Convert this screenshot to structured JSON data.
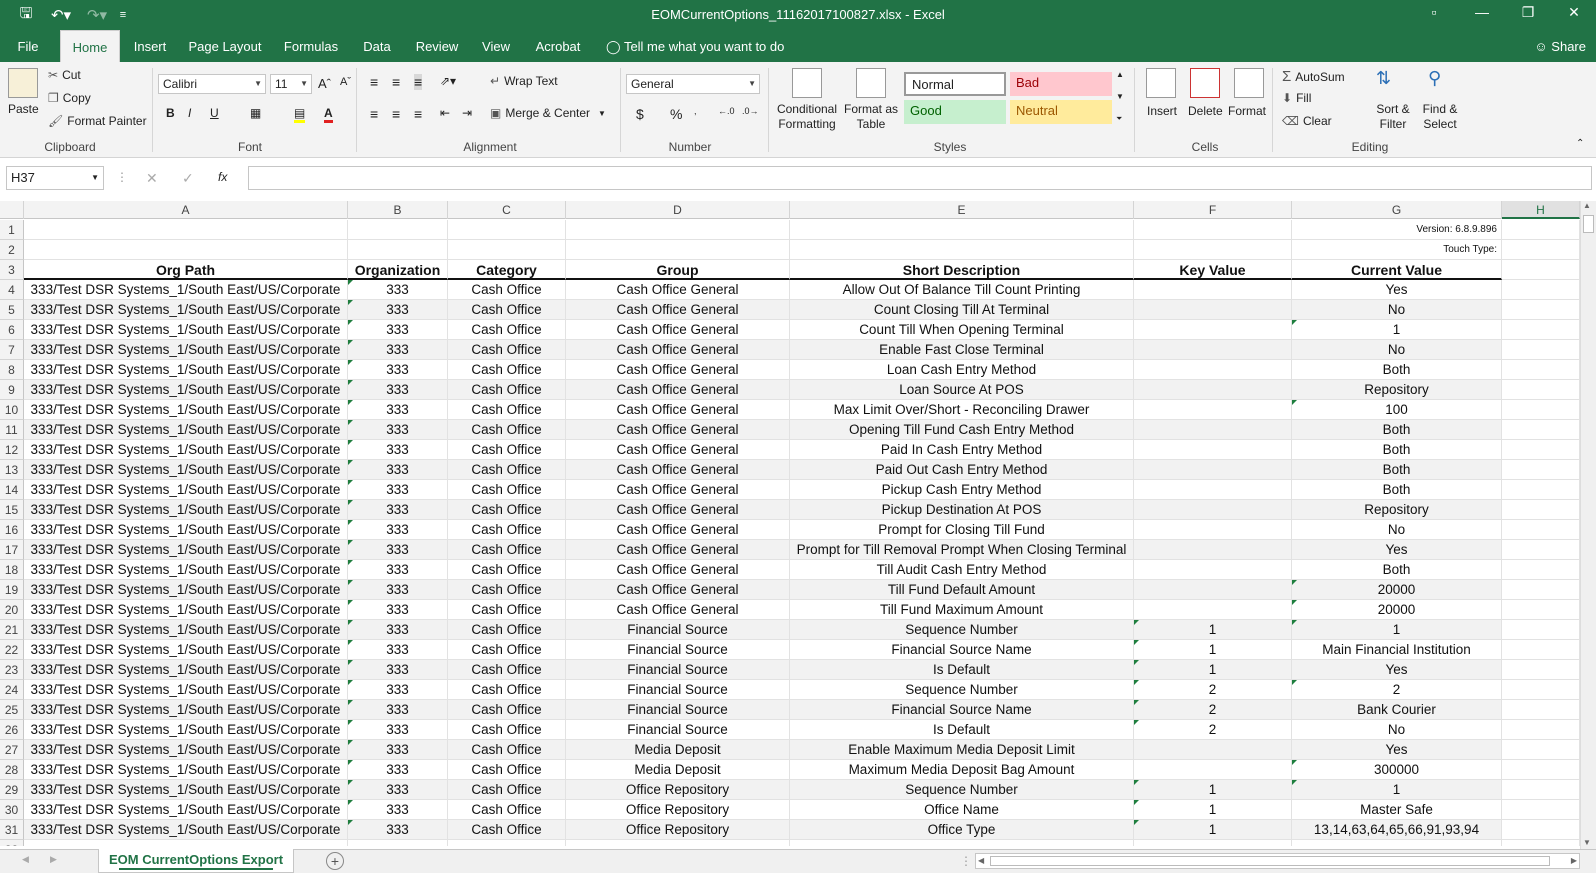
{
  "window": {
    "title": "EOMCurrentOptions_11162017100827.xlsx - Excel",
    "quick_access": [
      "save-icon",
      "undo-icon",
      "redo-icon",
      "customize-icon"
    ]
  },
  "tabs": [
    "File",
    "Home",
    "Insert",
    "Page Layout",
    "Formulas",
    "Data",
    "Review",
    "View",
    "Acrobat"
  ],
  "tell_me": "Tell me what you want to do",
  "share": "Share",
  "ribbon": {
    "clipboard": {
      "paste": "Paste",
      "cut": "Cut",
      "copy": "Copy",
      "format_painter": "Format Painter",
      "label": "Clipboard"
    },
    "font": {
      "name": "Calibri",
      "size": "11",
      "label": "Font",
      "bold": "B",
      "italic": "I",
      "underline": "U"
    },
    "alignment": {
      "wrap_text": "Wrap Text",
      "merge_center": "Merge & Center",
      "label": "Alignment"
    },
    "number": {
      "format": "General",
      "currency": "$",
      "percent": "%",
      "label": "Number"
    },
    "styles": {
      "conditional_formatting": "Conditional Formatting",
      "format_as_table": "Format as Table",
      "normal": "Normal",
      "bad": "Bad",
      "good": "Good",
      "neutral": "Neutral",
      "label": "Styles",
      "colors": {
        "normal_bg": "#ffffff",
        "bad_bg": "#ffc7ce",
        "bad_fg": "#9c0006",
        "good_bg": "#c6efce",
        "good_fg": "#006100",
        "neutral_bg": "#ffeb9c",
        "neutral_fg": "#9c5700"
      }
    },
    "cells": {
      "insert": "Insert",
      "delete": "Delete",
      "format": "Format",
      "label": "Cells"
    },
    "editing": {
      "autosum": "AutoSum",
      "fill": "Fill",
      "clear": "Clear",
      "sort_filter": "Sort & Filter",
      "find_select": "Find & Select",
      "label": "Editing"
    }
  },
  "formula_bar": {
    "name_box": "H37",
    "fx": "fx",
    "value": ""
  },
  "columns": [
    "A",
    "B",
    "C",
    "D",
    "E",
    "F",
    "G",
    "H"
  ],
  "version_text": "Version: 6.8.9.896",
  "touch_type_text": "Touch Type:",
  "headers": [
    "Org Path",
    "Organization",
    "Category",
    "Group",
    "Short Description",
    "Key Value",
    "Current Value"
  ],
  "rows": [
    [
      "333/Test DSR Systems_1/South East/US/Corporate",
      "333",
      "Cash Office",
      "Cash Office General",
      "Allow Out Of Balance Till Count Printing",
      "",
      "Yes"
    ],
    [
      "333/Test DSR Systems_1/South East/US/Corporate",
      "333",
      "Cash Office",
      "Cash Office General",
      "Count Closing Till At Terminal",
      "",
      "No"
    ],
    [
      "333/Test DSR Systems_1/South East/US/Corporate",
      "333",
      "Cash Office",
      "Cash Office General",
      "Count Till When Opening Terminal",
      "",
      "1"
    ],
    [
      "333/Test DSR Systems_1/South East/US/Corporate",
      "333",
      "Cash Office",
      "Cash Office General",
      "Enable Fast Close Terminal",
      "",
      "No"
    ],
    [
      "333/Test DSR Systems_1/South East/US/Corporate",
      "333",
      "Cash Office",
      "Cash Office General",
      "Loan Cash Entry Method",
      "",
      "Both"
    ],
    [
      "333/Test DSR Systems_1/South East/US/Corporate",
      "333",
      "Cash Office",
      "Cash Office General",
      "Loan Source At POS",
      "",
      "Repository"
    ],
    [
      "333/Test DSR Systems_1/South East/US/Corporate",
      "333",
      "Cash Office",
      "Cash Office General",
      "Max Limit Over/Short - Reconciling Drawer",
      "",
      "100"
    ],
    [
      "333/Test DSR Systems_1/South East/US/Corporate",
      "333",
      "Cash Office",
      "Cash Office General",
      "Opening Till Fund Cash Entry Method",
      "",
      "Both"
    ],
    [
      "333/Test DSR Systems_1/South East/US/Corporate",
      "333",
      "Cash Office",
      "Cash Office General",
      "Paid In Cash Entry Method",
      "",
      "Both"
    ],
    [
      "333/Test DSR Systems_1/South East/US/Corporate",
      "333",
      "Cash Office",
      "Cash Office General",
      "Paid Out Cash Entry Method",
      "",
      "Both"
    ],
    [
      "333/Test DSR Systems_1/South East/US/Corporate",
      "333",
      "Cash Office",
      "Cash Office General",
      "Pickup Cash Entry Method",
      "",
      "Both"
    ],
    [
      "333/Test DSR Systems_1/South East/US/Corporate",
      "333",
      "Cash Office",
      "Cash Office General",
      "Pickup Destination At POS",
      "",
      "Repository"
    ],
    [
      "333/Test DSR Systems_1/South East/US/Corporate",
      "333",
      "Cash Office",
      "Cash Office General",
      "Prompt for Closing Till Fund",
      "",
      "No"
    ],
    [
      "333/Test DSR Systems_1/South East/US/Corporate",
      "333",
      "Cash Office",
      "Cash Office General",
      "Prompt for Till Removal Prompt When Closing Terminal",
      "",
      "Yes"
    ],
    [
      "333/Test DSR Systems_1/South East/US/Corporate",
      "333",
      "Cash Office",
      "Cash Office General",
      "Till Audit Cash Entry Method",
      "",
      "Both"
    ],
    [
      "333/Test DSR Systems_1/South East/US/Corporate",
      "333",
      "Cash Office",
      "Cash Office General",
      "Till Fund Default Amount",
      "",
      "20000"
    ],
    [
      "333/Test DSR Systems_1/South East/US/Corporate",
      "333",
      "Cash Office",
      "Cash Office General",
      "Till Fund Maximum Amount",
      "",
      "20000"
    ],
    [
      "333/Test DSR Systems_1/South East/US/Corporate",
      "333",
      "Cash Office",
      "Financial Source",
      "Sequence Number",
      "1",
      "1"
    ],
    [
      "333/Test DSR Systems_1/South East/US/Corporate",
      "333",
      "Cash Office",
      "Financial Source",
      "Financial Source Name",
      "1",
      "Main Financial Institution"
    ],
    [
      "333/Test DSR Systems_1/South East/US/Corporate",
      "333",
      "Cash Office",
      "Financial Source",
      "Is Default",
      "1",
      "Yes"
    ],
    [
      "333/Test DSR Systems_1/South East/US/Corporate",
      "333",
      "Cash Office",
      "Financial Source",
      "Sequence Number",
      "2",
      "2"
    ],
    [
      "333/Test DSR Systems_1/South East/US/Corporate",
      "333",
      "Cash Office",
      "Financial Source",
      "Financial Source Name",
      "2",
      "Bank Courier"
    ],
    [
      "333/Test DSR Systems_1/South East/US/Corporate",
      "333",
      "Cash Office",
      "Financial Source",
      "Is Default",
      "2",
      "No"
    ],
    [
      "333/Test DSR Systems_1/South East/US/Corporate",
      "333",
      "Cash Office",
      "Media Deposit",
      "Enable Maximum Media Deposit Limit",
      "",
      "Yes"
    ],
    [
      "333/Test DSR Systems_1/South East/US/Corporate",
      "333",
      "Cash Office",
      "Media Deposit",
      "Maximum Media Deposit Bag Amount",
      "",
      "300000"
    ],
    [
      "333/Test DSR Systems_1/South East/US/Corporate",
      "333",
      "Cash Office",
      "Office Repository",
      "Sequence Number",
      "1",
      "1"
    ],
    [
      "333/Test DSR Systems_1/South East/US/Corporate",
      "333",
      "Cash Office",
      "Office Repository",
      "Office Name",
      "1",
      "Master Safe"
    ],
    [
      "333/Test DSR Systems_1/South East/US/Corporate",
      "333",
      "Cash Office",
      "Office Repository",
      "Office Type",
      "1",
      "13,14,63,64,65,66,91,93,94"
    ]
  ],
  "sheet_tab": "EOM CurrentOptions Export",
  "colors": {
    "excel_green": "#217346",
    "ribbon_bg": "#f3f3f3"
  }
}
